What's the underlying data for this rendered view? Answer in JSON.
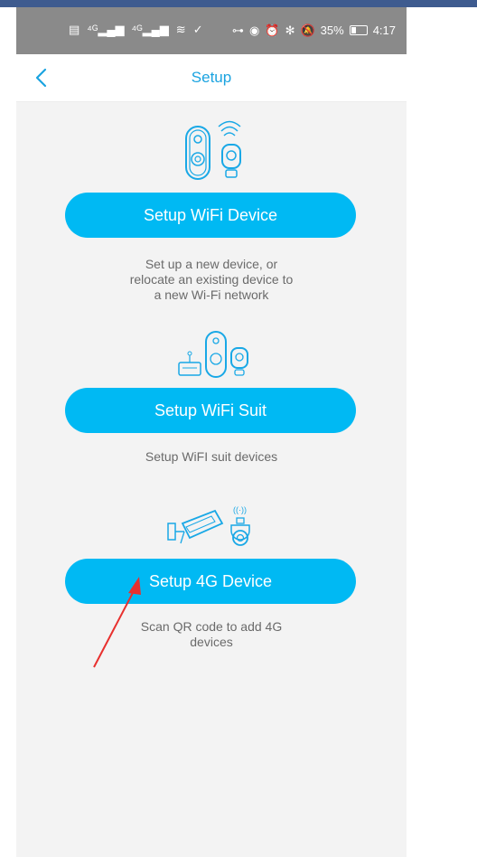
{
  "status_bar": {
    "left_icons": [
      "hd-icon",
      "signal-4g-icon",
      "signal-4g-icon",
      "wifi-icon",
      "app-icon"
    ],
    "right_icons": [
      "key-icon",
      "eye-icon",
      "alarm-icon",
      "bluetooth-icon",
      "mute-icon"
    ],
    "battery_percent": "35%",
    "time": "4:17"
  },
  "nav": {
    "title": "Setup"
  },
  "options": [
    {
      "button_label": "Setup WiFi Device",
      "description": "Set up a new device, or relocate an existing device to a new Wi-Fi network"
    },
    {
      "button_label": "Setup WiFi Suit",
      "description": "Setup WiFI suit devices"
    },
    {
      "button_label": "Setup 4G Device",
      "description": "Scan QR code to add 4G devices"
    }
  ],
  "colors": {
    "accent": "#00b9f3",
    "title": "#1aa3e0",
    "annotation_arrow": "#e8302e"
  }
}
